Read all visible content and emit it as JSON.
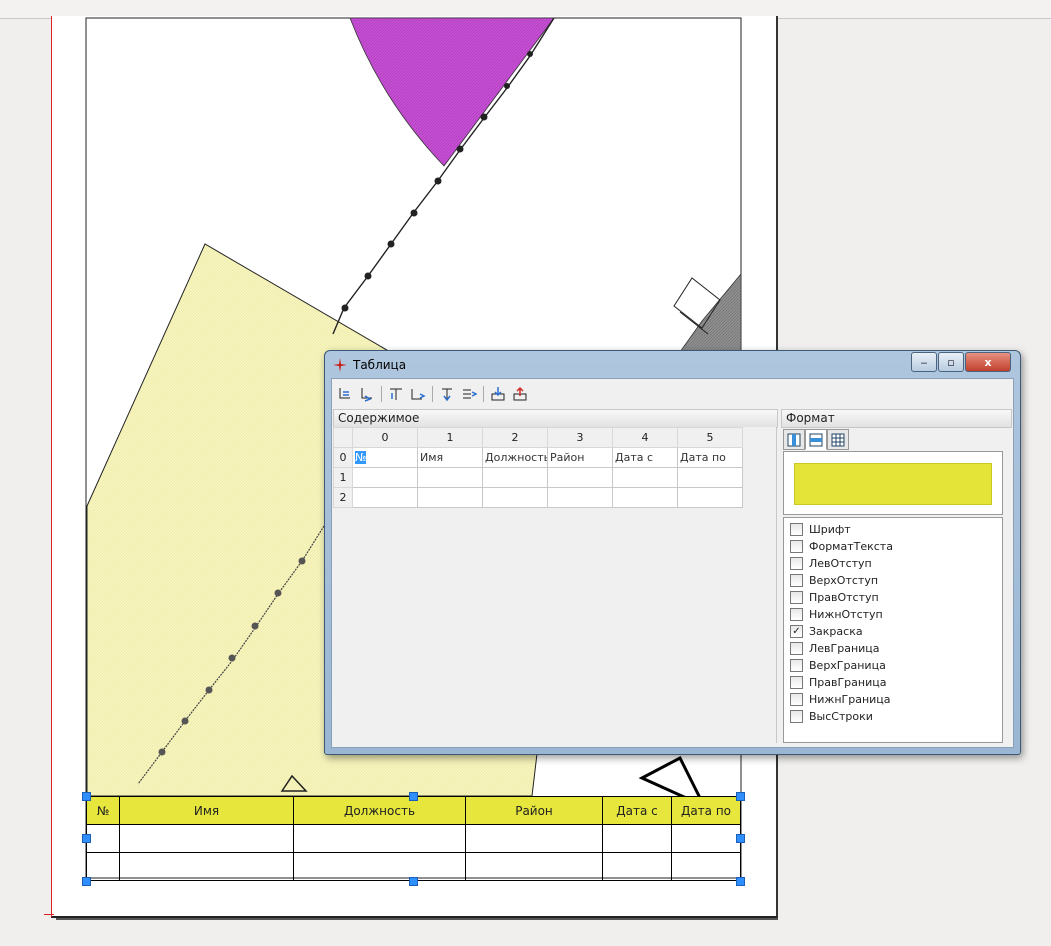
{
  "dialog": {
    "title": "Таблица",
    "minimize": "‒",
    "maximize": "▫",
    "close": "x",
    "toolbar": [
      "insert-row-above-icon",
      "insert-row-below-icon",
      "insert-col-left-icon",
      "insert-col-right-icon",
      "delete-row-icon",
      "delete-col-icon",
      "import-icon",
      "export-icon"
    ],
    "content_panel": "Содержимое",
    "format_panel": "Формат",
    "grid": {
      "col_headers": [
        "0",
        "1",
        "2",
        "3",
        "4",
        "5"
      ],
      "rows": [
        {
          "index": "0",
          "cells": [
            "№",
            "Имя",
            "Должность",
            "Район",
            "Дата с",
            "Дата по"
          ]
        },
        {
          "index": "1",
          "cells": [
            "",
            "",
            "",
            "",
            "",
            ""
          ]
        },
        {
          "index": "2",
          "cells": [
            "",
            "",
            "",
            "",
            "",
            ""
          ]
        }
      ]
    },
    "fill_color": "#e3e338",
    "properties": [
      {
        "label": "Шрифт",
        "checked": false
      },
      {
        "label": "ФорматТекста",
        "checked": false
      },
      {
        "label": "ЛевОтступ",
        "checked": false
      },
      {
        "label": "ВерхОтступ",
        "checked": false
      },
      {
        "label": "ПравОтступ",
        "checked": false
      },
      {
        "label": "НижнОтступ",
        "checked": false
      },
      {
        "label": "Закраска",
        "checked": true
      },
      {
        "label": "ЛевГраница",
        "checked": false
      },
      {
        "label": "ВерхГраница",
        "checked": false
      },
      {
        "label": "ПравГраница",
        "checked": false
      },
      {
        "label": "НижнГраница",
        "checked": false
      },
      {
        "label": "ВысСтроки",
        "checked": false
      }
    ]
  },
  "print_table": {
    "headers": [
      "№",
      "Имя",
      "Должность",
      "Район",
      "Дата с",
      "Дата по"
    ],
    "header_color": "#e6e63c"
  },
  "colors": {
    "magenta_region": "#c64fd4",
    "yellow_region": "#f7f5bf",
    "selection_handle": "#2f8fff"
  }
}
